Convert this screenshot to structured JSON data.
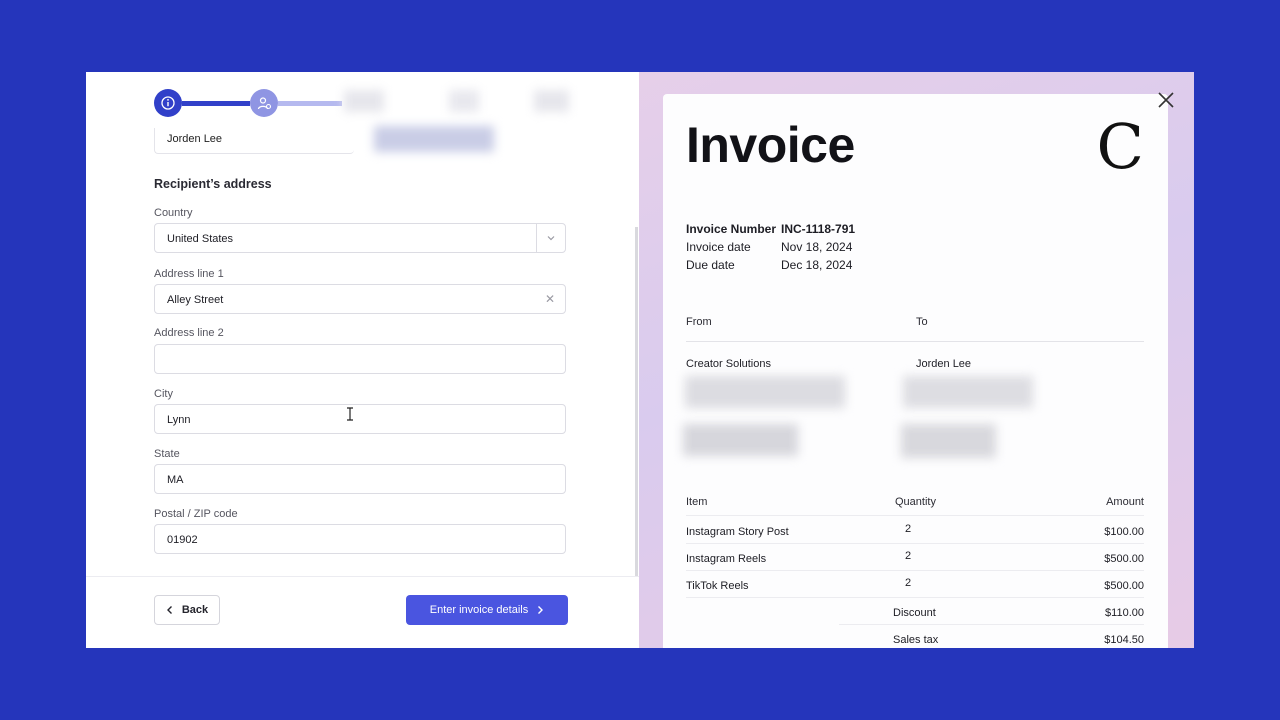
{
  "form": {
    "previous_field_value": "Jorden Lee",
    "section_title": "Recipient’s address",
    "country": {
      "label": "Country",
      "value": "United States"
    },
    "address1": {
      "label": "Address line 1",
      "value": "Alley Street"
    },
    "address2": {
      "label": "Address line 2",
      "value": ""
    },
    "city": {
      "label": "City",
      "value": "Lynn"
    },
    "state": {
      "label": "State",
      "value": "MA"
    },
    "zip": {
      "label": "Postal / ZIP code",
      "value": "01902"
    },
    "back_label": "Back",
    "next_label": "Enter invoice details"
  },
  "invoice": {
    "title": "Invoice",
    "logo_letter": "C",
    "number_label": "Invoice Number",
    "number": "INC-1118-791",
    "date_label": "Invoice date",
    "date": "Nov 18, 2024",
    "due_label": "Due date",
    "due": "Dec 18, 2024",
    "from_label": "From",
    "to_label": "To",
    "from_name": "Creator Solutions",
    "to_name": "Jorden Lee",
    "columns": {
      "item": "Item",
      "quantity": "Quantity",
      "amount": "Amount"
    },
    "items": [
      {
        "name": "Instagram Story Post",
        "quantity": "2",
        "amount": "$100.00"
      },
      {
        "name": "Instagram Reels",
        "quantity": "2",
        "amount": "$500.00"
      },
      {
        "name": "TikTok Reels",
        "quantity": "2",
        "amount": "$500.00"
      }
    ],
    "discount_label": "Discount",
    "discount": "$110.00",
    "tax_label": "Sales tax",
    "tax": "$104.50"
  },
  "colors": {
    "background": "#2535bb",
    "accent": "#4a55e0",
    "step_active": "#3140c9",
    "step_pending": "#8f95e3"
  }
}
